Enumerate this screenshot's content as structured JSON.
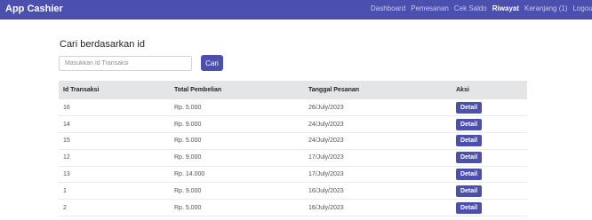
{
  "app": {
    "brand": "App Cashier"
  },
  "nav": {
    "items": [
      {
        "label": "Dashboard",
        "active": false
      },
      {
        "label": "Pemesanan",
        "active": false
      },
      {
        "label": "Cek Saldo",
        "active": false
      },
      {
        "label": "Riwayat",
        "active": true
      },
      {
        "label": "Keranjang (1)",
        "active": false
      },
      {
        "label": "Logout",
        "active": false
      }
    ]
  },
  "search": {
    "title": "Cari berdasarkan id",
    "placeholder": "Masukkan Id Transaksi",
    "value": "",
    "button_label": "Cari"
  },
  "table": {
    "headers": [
      "Id Transaksi",
      "Total Pembelian",
      "Tanggal Pesanan",
      "Aksi"
    ],
    "rows": [
      {
        "id": "16",
        "total": "Rp. 5.000",
        "date": "26/July/2023",
        "action": "Detail"
      },
      {
        "id": "14",
        "total": "Rp. 9.000",
        "date": "24/July/2023",
        "action": "Detail"
      },
      {
        "id": "15",
        "total": "Rp. 5.000",
        "date": "24/July/2023",
        "action": "Detail"
      },
      {
        "id": "12",
        "total": "Rp. 9.000",
        "date": "17/July/2023",
        "action": "Detail"
      },
      {
        "id": "13",
        "total": "Rp. 14.000",
        "date": "17/July/2023",
        "action": "Detail"
      },
      {
        "id": "1",
        "total": "Rp. 9.000",
        "date": "16/July/2023",
        "action": "Detail"
      },
      {
        "id": "2",
        "total": "Rp. 5.000",
        "date": "16/July/2023",
        "action": "Detail"
      }
    ]
  },
  "colors": {
    "accent": "#4b4fae",
    "header_bg": "#e4e5e7"
  }
}
